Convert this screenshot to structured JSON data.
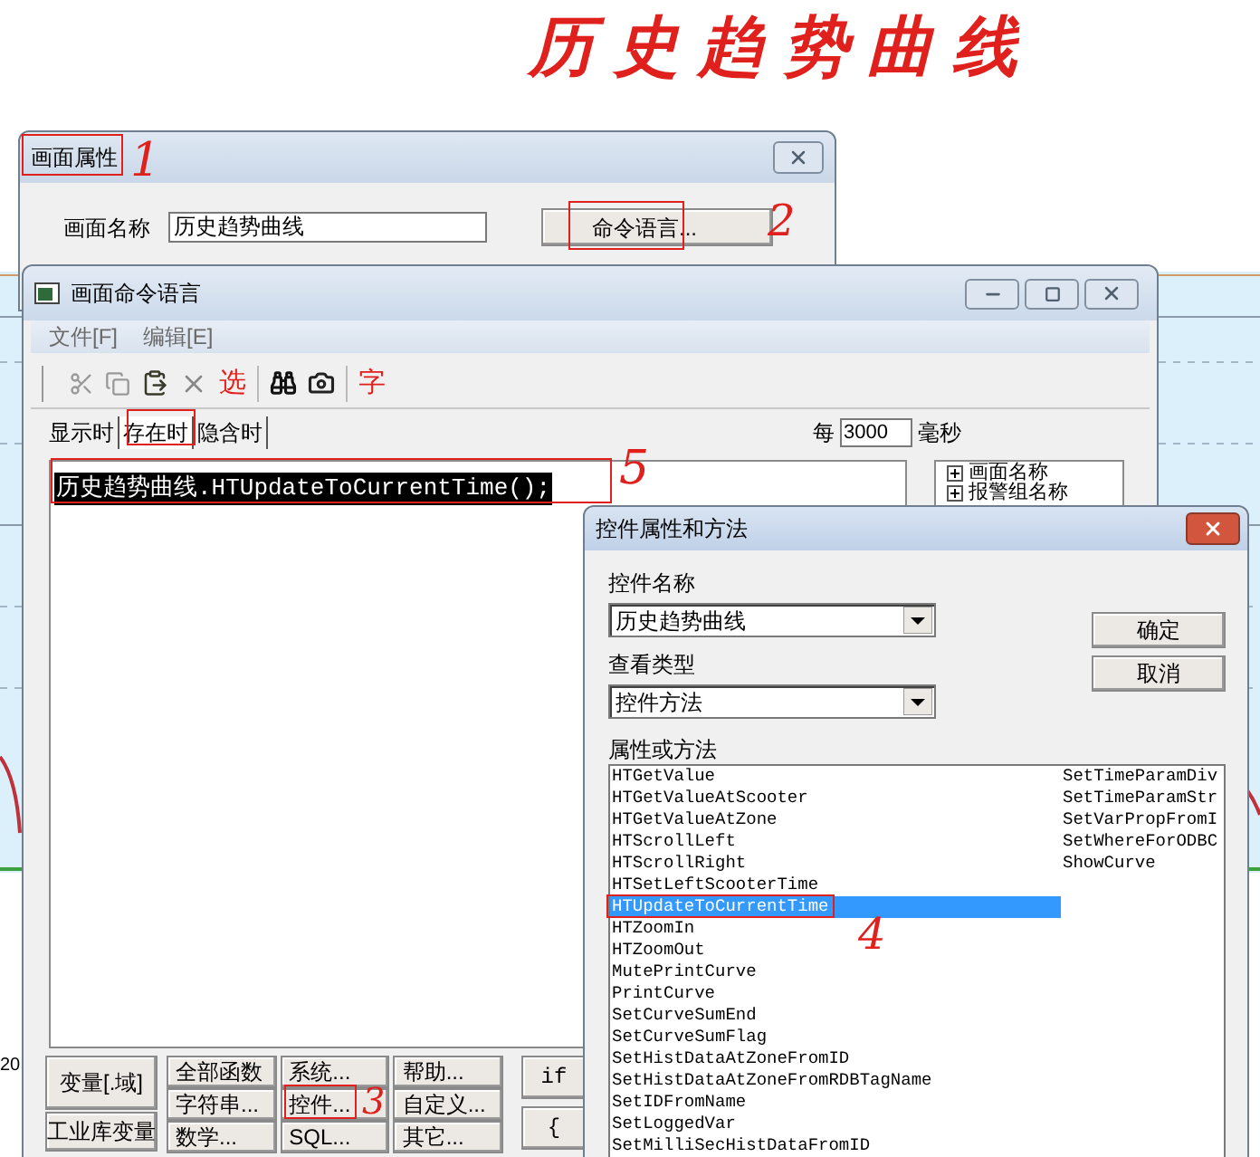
{
  "page_title": "历史趋势曲线",
  "background": {
    "axis_text": "20"
  },
  "properties_window": {
    "title": "画面属性",
    "name_label": "画面名称",
    "name_value": "历史趋势曲线",
    "command_button": "命令语言..."
  },
  "command_window": {
    "title": "画面命令语言",
    "menu": [
      "文件[F]",
      "编辑[E]"
    ],
    "toolbar": {
      "select_label": "选",
      "font_label": "字"
    },
    "tabs": [
      {
        "label": "显示时",
        "selected": false
      },
      {
        "label": "存在时",
        "selected": true
      },
      {
        "label": "隐含时",
        "selected": false
      }
    ],
    "interval": {
      "prefix": "每",
      "value": "3000",
      "unit": "毫秒"
    },
    "editor_lines": [
      {
        "text": "历史趋势曲线.HTUpdateToCurrentTime();",
        "selected": true
      }
    ],
    "tree": [
      {
        "label": "画面名称",
        "expanded": false
      },
      {
        "label": "报警组名称",
        "expanded": false
      }
    ],
    "side_buttons": [
      "变量[.域]",
      "工业库变量"
    ],
    "function_buttons": [
      "全部函数",
      "系统...",
      "帮助...",
      "字符串...",
      "控件...",
      "自定义...",
      "数学...",
      "SQL...",
      "其它..."
    ],
    "syntax_buttons": [
      "if",
      "{"
    ]
  },
  "control_dialog": {
    "title": "控件属性和方法",
    "name_label": "控件名称",
    "name_value": "历史趋势曲线",
    "type_label": "查看类型",
    "type_value": "控件方法",
    "list_label": "属性或方法",
    "ok": "确定",
    "cancel": "取消",
    "items": [
      {
        "label": "HTGetValue",
        "selected": false
      },
      {
        "label": "HTGetValueAtScooter",
        "selected": false
      },
      {
        "label": "HTGetValueAtZone",
        "selected": false
      },
      {
        "label": "HTScrollLeft",
        "selected": false
      },
      {
        "label": "HTScrollRight",
        "selected": false
      },
      {
        "label": "HTSetLeftScooterTime",
        "selected": false
      },
      {
        "label": "HTUpdateToCurrentTime",
        "selected": true
      },
      {
        "label": "HTZoomIn",
        "selected": false
      },
      {
        "label": "HTZoomOut",
        "selected": false
      },
      {
        "label": "MutePrintCurve",
        "selected": false
      },
      {
        "label": "PrintCurve",
        "selected": false
      },
      {
        "label": "SetCurveSumEnd",
        "selected": false
      },
      {
        "label": "SetCurveSumFlag",
        "selected": false
      },
      {
        "label": "SetHistDataAtZoneFromID",
        "selected": false
      },
      {
        "label": "SetHistDataAtZoneFromRDBTagName",
        "selected": false
      },
      {
        "label": "SetIDFromName",
        "selected": false
      },
      {
        "label": "SetLoggedVar",
        "selected": false
      },
      {
        "label": "SetMilliSecHistDataFromID",
        "selected": false
      },
      {
        "label": "SetTimeParamDiv",
        "selected": false
      },
      {
        "label": "SetTimeParamStr",
        "selected": false
      },
      {
        "label": "SetVarPropFromI",
        "selected": false
      },
      {
        "label": "SetWhereForODBC",
        "selected": false
      },
      {
        "label": "ShowCurve",
        "selected": false
      }
    ]
  },
  "annotations": [
    {
      "kind": "numbered",
      "label": "1"
    },
    {
      "kind": "numbered",
      "label": "2"
    },
    {
      "kind": "box"
    },
    {
      "kind": "numbered",
      "label": "5"
    },
    {
      "kind": "numbered",
      "label": "4"
    },
    {
      "kind": "numbered",
      "label": "3"
    }
  ]
}
